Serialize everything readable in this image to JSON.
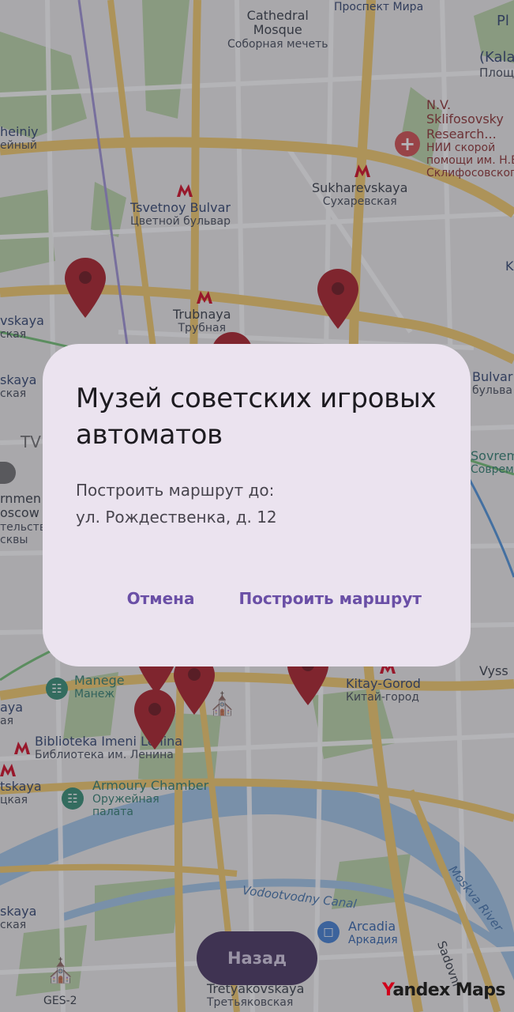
{
  "map": {
    "labels": {
      "cathedral_en": "Cathedral",
      "cathedral_en2": "Mosque",
      "cathedral_ru": "Соборная мечеть",
      "prospekt_ru": "Проспект Мира",
      "pl": "Pl",
      "kala": "(Kala",
      "ploshad": "Площадь",
      "sklif_en1": "N.V.",
      "sklif_en2": "Sklifosovsky",
      "sklif_en3": "Research...",
      "sklif_ru1": "НИИ скорой",
      "sklif_ru2": "помощи им. Н.В.",
      "sklif_ru3": "Склифосовского",
      "heiniy": "heiniy",
      "eyniy": "ейный",
      "sukharevskaya_en": "Sukharevskaya",
      "sukharevskaya_ru": "Сухаревская",
      "tsvetnoy_en": "Tsvetnoy Bulvar",
      "tsvetnoy_ru": "Цветной бульвар",
      "trubnaya_en": "Trubnaya",
      "trubnaya_ru": "Трубная",
      "vskaya": "vskaya",
      "skaya_ru": "ская",
      "k": "K",
      "skaya2": "skaya",
      "skaya2_ru": "ская",
      "bulvar_en": "Bulvar",
      "bulvar_ru": "бульва",
      "tv": "TV",
      "sovrem_en": "Sovrem",
      "sovrem_ru": "Соврем",
      "rnmen": "rnmen",
      "oscow": "oscow",
      "telstva": "тельства",
      "skvy": "сквы",
      "manege_en": "Manege",
      "manege_ru": "Манеж",
      "kitay_en": "Kitay-Gorod",
      "kitay_ru": "Китай-город",
      "vyss": "Vyss",
      "aya": "aya",
      "aya_ru": "ая",
      "biblioteka_en": "Biblioteka Imeni Lenina",
      "biblioteka_ru": "Библиотека им. Ленина",
      "tskaya": "tskaya",
      "tskaya_ru": "цкая",
      "armoury_en": "Armoury Chamber",
      "armoury_ru1": "Оружейная",
      "armoury_ru2": "палата",
      "vodootvodny": "Vodootvodny Canal",
      "moskva_river": "Moskva River",
      "skaya3": "skaya",
      "skaya3_ru": "ская",
      "arcadia_en": "Arcadia",
      "arcadia_ru": "Аркадия",
      "sadovni": "Sadovni",
      "ges2": "GES-2",
      "tretyakovskaya_en": "Tretyakovskaya",
      "tretyakovskaya_ru": "Третьяковская"
    },
    "colors": {
      "pin": "#a81820",
      "metro": "#d0021b",
      "road_major": "#f2c865",
      "park": "#b9d3a3",
      "river": "#9fc3e6"
    }
  },
  "dialog": {
    "title": "Музей советских игровых автоматов",
    "body_line1": "Построить маршрут до:",
    "body_line2": "ул. Рождественка, д. 12",
    "cancel_label": "Отмена",
    "confirm_label": "Построить маршрут"
  },
  "back_button": {
    "label": "Назад"
  },
  "logo": {
    "y": "Y",
    "rest": "andex Maps"
  }
}
